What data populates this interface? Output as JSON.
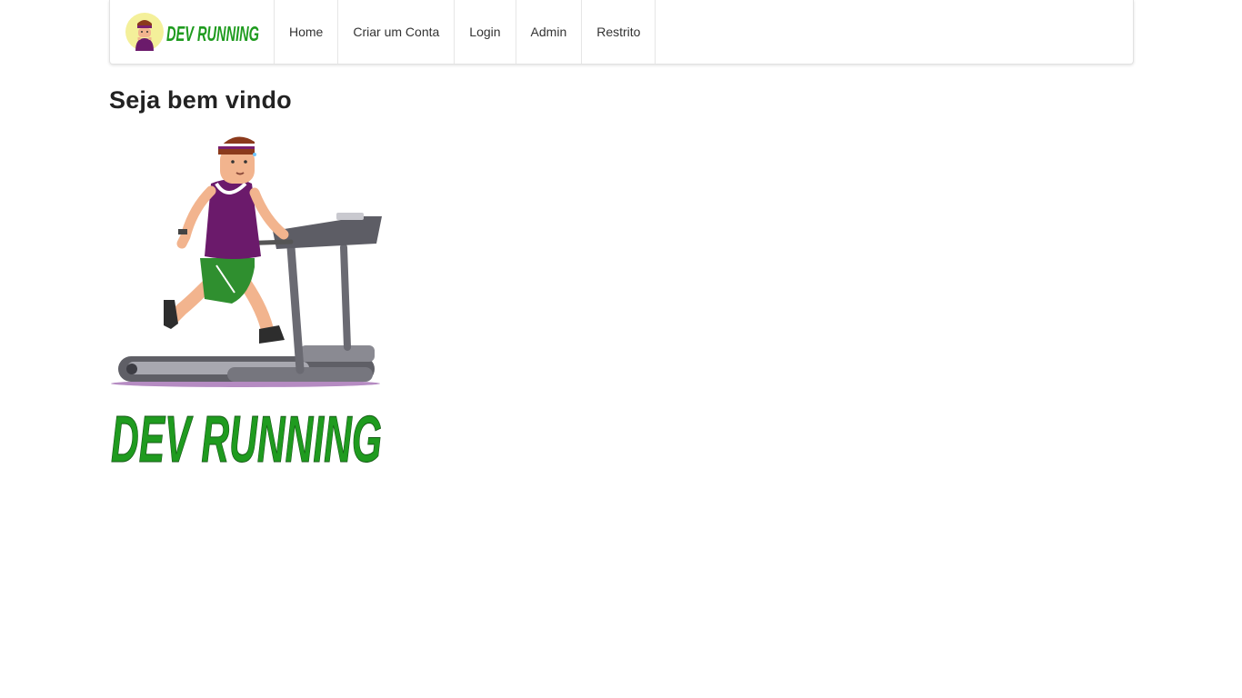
{
  "brand": {
    "logo_text": "DEV RUNNING",
    "logo_color": "#1f9b1f"
  },
  "nav": {
    "items": [
      {
        "label": "Home"
      },
      {
        "label": "Criar um Conta"
      },
      {
        "label": "Login"
      },
      {
        "label": "Admin"
      },
      {
        "label": "Restrito"
      }
    ]
  },
  "main": {
    "title": "Seja bem vindo",
    "hero_image": {
      "icon": "runner-on-treadmill-illustration",
      "logo_text": "DEV RUNNING",
      "logo_color": "#1f9b1f"
    }
  }
}
